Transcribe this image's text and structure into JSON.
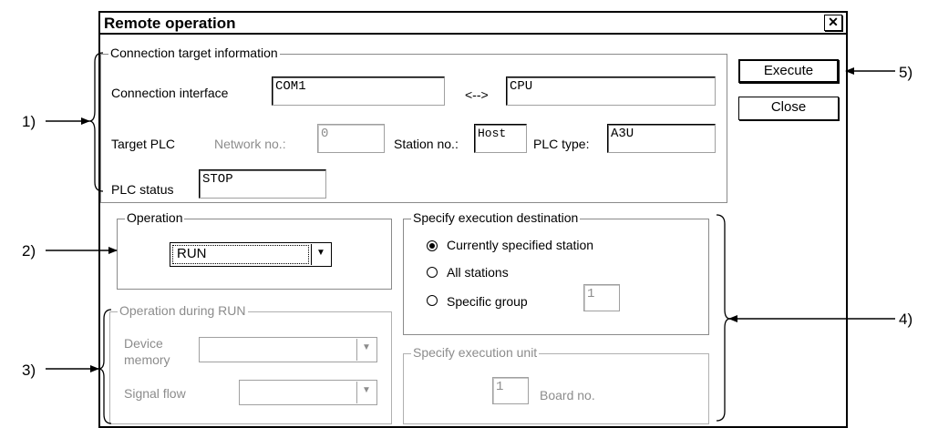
{
  "dialog": {
    "title": "Remote operation",
    "close_symbol": "✕"
  },
  "connection": {
    "group_label": "Connection target information",
    "interface_label": "Connection interface",
    "interface_value": "COM1",
    "arrow_text": "<-->",
    "cpu_value": "CPU",
    "target_plc_label": "Target PLC",
    "network_label": "Network no.:",
    "network_value": "0",
    "station_label": "Station no.:",
    "station_value": "Host",
    "plc_type_label": "PLC type:",
    "plc_type_value": "A3U",
    "plc_status_label": "PLC status",
    "plc_status_value": "STOP"
  },
  "buttons": {
    "execute": "Execute",
    "close": "Close"
  },
  "operation": {
    "group_label": "Operation",
    "selected": "RUN"
  },
  "during_run": {
    "group_label": "Operation during RUN",
    "device_memory_label_1": "Device",
    "device_memory_label_2": "memory",
    "device_memory_value": "",
    "signal_flow_label": "Signal flow",
    "signal_flow_value": ""
  },
  "destination": {
    "group_label": "Specify execution destination",
    "options": [
      "Currently specified station",
      "All stations",
      "Specific group"
    ],
    "selected_index": 0,
    "group_value": "1"
  },
  "unit": {
    "group_label": "Specify execution unit",
    "board_value": "1",
    "board_label": "Board no."
  },
  "callouts": {
    "c1": "1)",
    "c2": "2)",
    "c3": "3)",
    "c4": "4)",
    "c5": "5)"
  }
}
